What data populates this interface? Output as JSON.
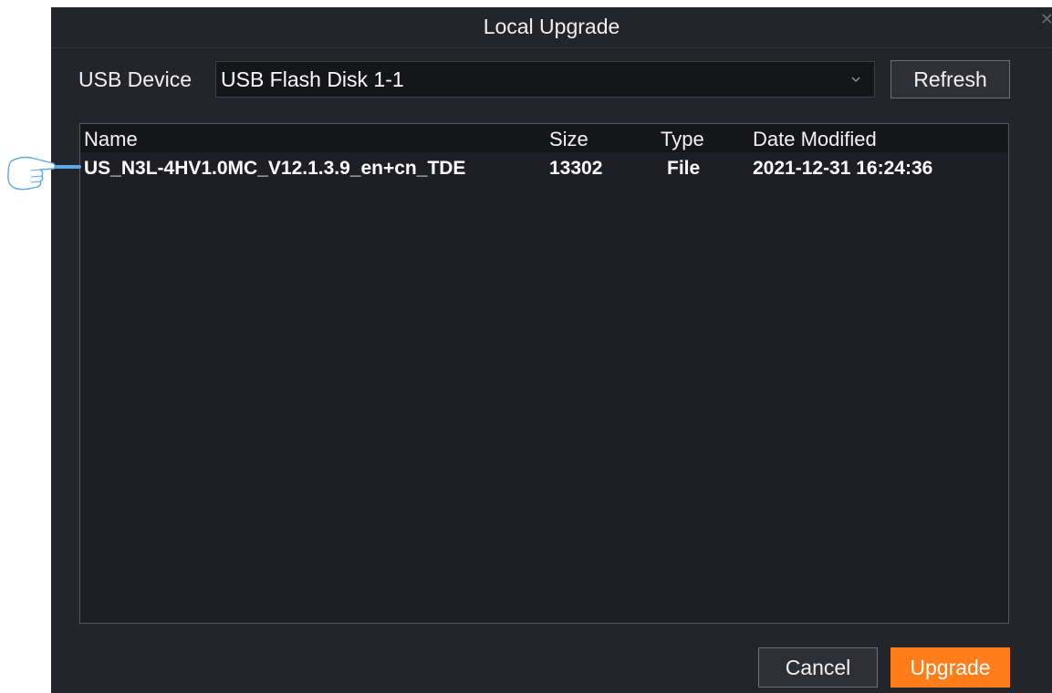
{
  "dialog": {
    "title": "Local Upgrade"
  },
  "usb": {
    "label": "USB Device",
    "selected_device": "USB Flash Disk 1-1",
    "refresh_label": "Refresh"
  },
  "table": {
    "columns": [
      "Name",
      "Size",
      "Type",
      "Date Modified"
    ],
    "rows": [
      {
        "name": "US_N3L-4HV1.0MC_V12.1.3.9_en+cn_TDE",
        "size": "13302",
        "type": "File",
        "date_modified": "2021-12-31  16:24:36"
      }
    ]
  },
  "actions": {
    "cancel_label": "Cancel",
    "upgrade_label": "Upgrade"
  },
  "icons": {
    "dropdown": "chevron-down-icon",
    "close": "close-icon",
    "annotation": "pointer-hand-icon"
  },
  "colors": {
    "dialog_background": "#24252b",
    "accent": "#ff7d1a",
    "table_background": "#1e1f24",
    "annotation": "#5aa9e6"
  }
}
